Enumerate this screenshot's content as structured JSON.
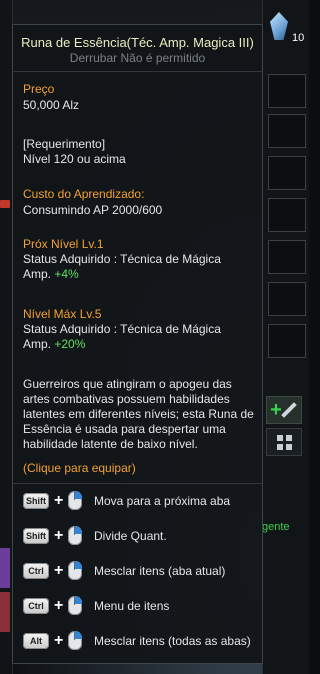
{
  "tooltip": {
    "title": "Runa de Essência(Téc. Amp. Magica III)",
    "subtitle": "Derrubar Não é permitido",
    "price_label": "Preço",
    "price_value": "50,000 Alz",
    "requirement_label": "[Requerimento]",
    "requirement_value": "Nível 120 ou acima",
    "learn_cost_label": "Custo do Aprendizado:",
    "learn_cost_value": "Consumindo AP 2000/600",
    "next_level_label": "Próx Nível",
    "next_level_lv": "Lv.1",
    "next_status_line1": "Status Adquirido : Técnica de Mágica",
    "next_status_prefix": "Amp.",
    "next_status_value": "+4%",
    "max_level_label": "Nível Máx",
    "max_level_lv": "Lv.5",
    "max_status_line1": "Status Adquirido : Técnica de Mágica",
    "max_status_prefix": "Amp.",
    "max_status_value": "+20%",
    "description": "Guerreiros que atingiram o apogeu das artes combativas possuem habilidades latentes em diferentes níveis; esta Runa de Essência é usada para despertar uma habilidade latente de baixo nível.",
    "click_hint": "(Clique para equipar)",
    "shortcuts": [
      {
        "key": "Shift",
        "label": "Mova para a próxima aba"
      },
      {
        "key": "Shift",
        "label": "Divide Quant."
      },
      {
        "key": "Ctrl",
        "label": "Mesclar itens (aba atual)"
      },
      {
        "key": "Ctrl",
        "label": "Menu de itens"
      },
      {
        "key": "Alt",
        "label": "Mesclar itens (todas as abas)"
      }
    ]
  },
  "inventory": {
    "crystal_count": "10",
    "side_text": "gente"
  },
  "colors": {
    "accent_orange": "#f2a12e",
    "positive_green": "#5fe05f",
    "title": "#e9edc0"
  }
}
